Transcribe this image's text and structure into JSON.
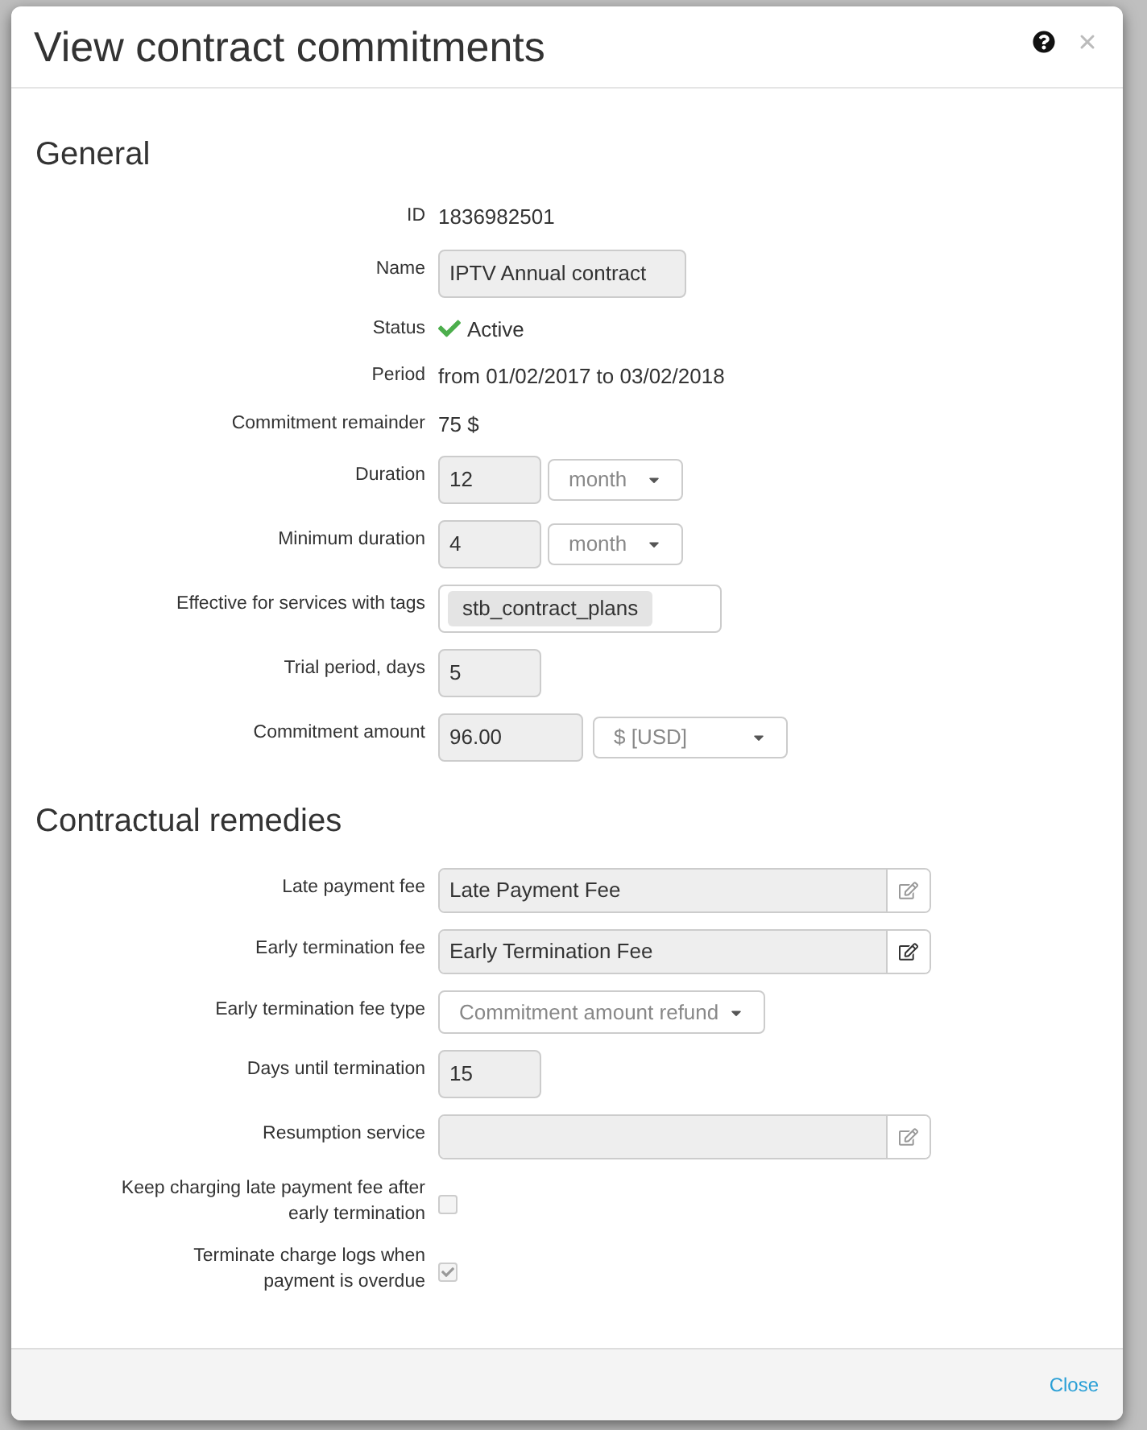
{
  "dialog": {
    "title": "View contract commitments",
    "close_link": "Close"
  },
  "sections": [
    {
      "heading": "General",
      "rows": [
        {
          "label": "ID",
          "kind": "text",
          "value": "1836982501"
        },
        {
          "label": "Name",
          "kind": "input",
          "value": "IPTV Annual contract"
        },
        {
          "label": "Status",
          "kind": "status",
          "value": "Active"
        },
        {
          "label": "Period",
          "kind": "text",
          "value": "from 01/02/2017 to 03/02/2018"
        },
        {
          "label": "Commitment remainder",
          "kind": "text",
          "value": "75 $"
        },
        {
          "label": "Duration",
          "kind": "input-select",
          "value": "12",
          "option": "month"
        },
        {
          "label": "Minimum duration",
          "kind": "input-select",
          "value": "4",
          "option": "month"
        },
        {
          "label": "Effective for services with tags",
          "kind": "tags",
          "tags": [
            "stb_contract_plans"
          ]
        },
        {
          "label": "Trial period, days",
          "kind": "input",
          "value": "5"
        },
        {
          "label": "Commitment amount",
          "kind": "input-select",
          "value": "96.00",
          "option": "$ [USD]"
        }
      ]
    },
    {
      "heading": "Contractual remedies",
      "rows": [
        {
          "label": "Late payment fee",
          "kind": "input-button",
          "value": "Late Payment Fee",
          "disabled": true
        },
        {
          "label": "Early termination fee",
          "kind": "input-button",
          "value": "Early Termination Fee",
          "disabled": false
        },
        {
          "label": "Early termination fee type",
          "kind": "select",
          "option": "Commitment amount refund"
        },
        {
          "label": "Days until termination",
          "kind": "input",
          "value": "15"
        },
        {
          "label": "Resumption service",
          "kind": "input-button",
          "disabled": true
        },
        {
          "label": "Keep charging late payment fee after early termination",
          "kind": "checkbox",
          "checked": false
        },
        {
          "label": "Terminate charge logs when payment is overdue",
          "kind": "checkbox",
          "checked": true
        }
      ]
    }
  ]
}
